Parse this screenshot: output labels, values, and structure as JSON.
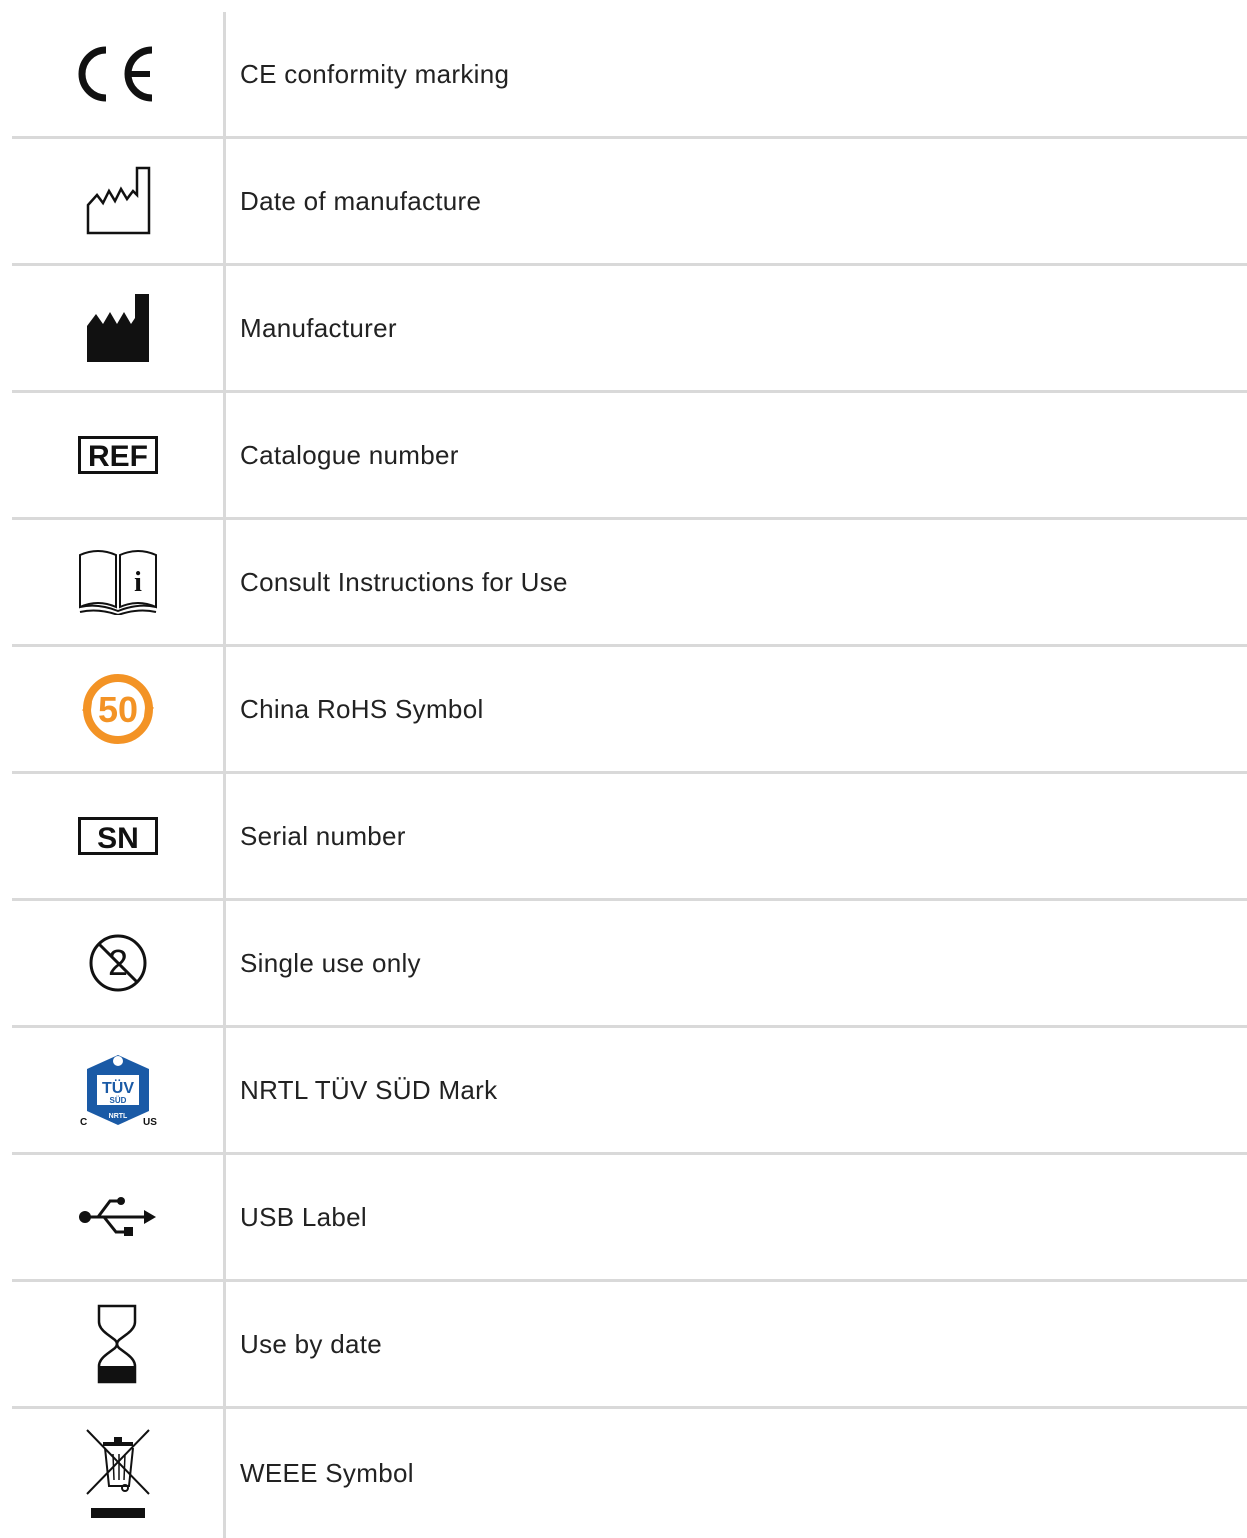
{
  "symbols": [
    {
      "icon": "ce-mark-icon",
      "label": "CE conformity marking"
    },
    {
      "icon": "date-of-manufacture-icon",
      "label": "Date of manufacture"
    },
    {
      "icon": "manufacturer-icon",
      "label": "Manufacturer"
    },
    {
      "icon": "ref-catalogue-icon",
      "label": "Catalogue number",
      "icon_text": "REF"
    },
    {
      "icon": "consult-ifu-icon",
      "label": "Consult Instructions for Use",
      "icon_text": "i"
    },
    {
      "icon": "china-rohs-icon",
      "label": "China RoHS Symbol",
      "icon_text": "50"
    },
    {
      "icon": "serial-number-icon",
      "label": "Serial number",
      "icon_text": "SN"
    },
    {
      "icon": "single-use-icon",
      "label": "Single use only",
      "icon_text": "2"
    },
    {
      "icon": "tuv-sud-nrtl-icon",
      "label": "NRTL TÜV SÜD Mark",
      "icon_text": {
        "top": "TÜV",
        "mid": "SÜD",
        "bottom": "NRTL",
        "left": "C",
        "right": "US"
      }
    },
    {
      "icon": "usb-icon",
      "label": "USB Label"
    },
    {
      "icon": "use-by-date-icon",
      "label": "Use by date"
    },
    {
      "icon": "weee-icon",
      "label": "WEEE Symbol"
    }
  ],
  "colors": {
    "divider": "#d9d9d9",
    "rohs_orange": "#f39325",
    "tuv_blue": "#1a5aa6"
  }
}
